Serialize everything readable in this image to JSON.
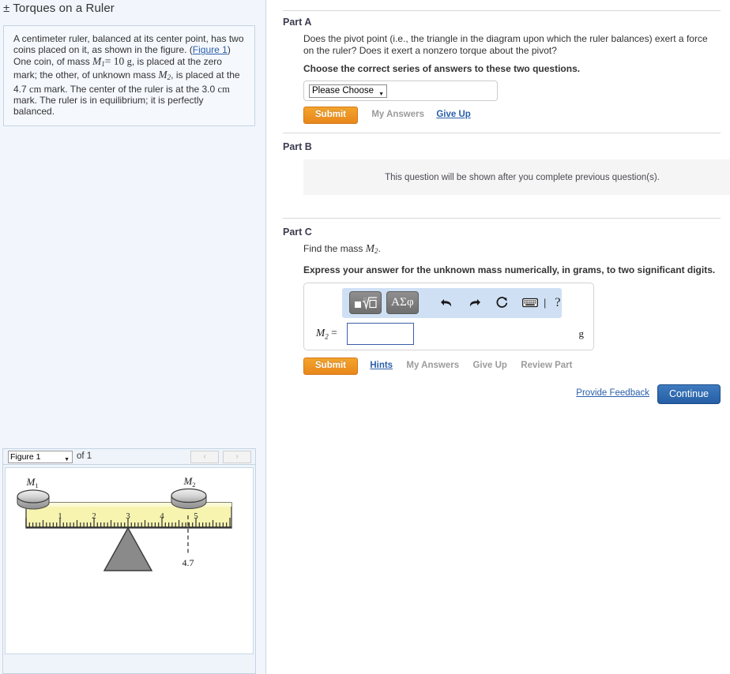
{
  "problem": {
    "title": "± Torques on a Ruler",
    "statement_parts": [
      "A centimeter ruler, balanced at its center point, has two coins placed on it, as shown in the figure. (",
      "Figure 1",
      ") One coin, of mass ",
      "M",
      "1",
      " = 10 ",
      "g",
      ", is placed at the zero mark; the other, of unknown mass ",
      "M",
      "2",
      ", is placed at the 4.7 ",
      "cm",
      " mark. The center of the ruler is at the 3.0 ",
      "cm",
      " mark. The ruler is in equilibrium; it is perfectly balanced."
    ],
    "figure_link": "Figure 1",
    "mass1_symbol": "M",
    "mass1_sub": "1",
    "mass1_value": "= 10",
    "mass1_unit": "g",
    "mass2_symbol": "M",
    "mass2_sub": "2",
    "coin2_position": "4.7",
    "center_position": "3.0",
    "unit_cm": "cm"
  },
  "parts": {
    "a": {
      "heading": "Part A",
      "question": "Does the pivot point (i.e., the triangle in the diagram upon which the ruler balances) exert a force on the ruler? Does it exert a nonzero torque about the pivot?",
      "instruction": "Choose the correct series of answers to these two questions.",
      "select_value": "Please Choose",
      "submit_label": "Submit",
      "my_answers_label": "My Answers",
      "give_up_label": "Give Up"
    },
    "b": {
      "heading": "Part B",
      "locked_message": "This question will be shown after you complete previous question(s)."
    },
    "c": {
      "heading": "Part C",
      "question_prefix": "Find the mass ",
      "question_symbol": "M",
      "question_sub": "2",
      "question_suffix": ".",
      "instruction": "Express your answer for the unknown mass numerically, in grams, to two significant digits.",
      "answer_label_symbol": "M",
      "answer_label_sub": "2",
      "answer_label_eq": "=",
      "answer_value": "",
      "answer_unit": "g",
      "submit_label": "Submit",
      "hints_label": "Hints",
      "my_answers_label": "My Answers",
      "give_up_label": "Give Up",
      "review_part_label": "Review Part",
      "toolbar": {
        "template_icon": "math-template-icon",
        "greek_label": "ΑΣφ",
        "undo_icon": "undo-arrow-icon",
        "redo_icon": "redo-arrow-icon",
        "reset_icon": "reset-circular-arrow-icon",
        "keyboard_icon": "keyboard-icon",
        "help_label": "?"
      }
    }
  },
  "footer": {
    "feedback_label": "Provide Feedback",
    "continue_label": "Continue"
  },
  "figure": {
    "select_value": "Figure 1",
    "of_label": "of 1",
    "prev_label": "‹",
    "next_label": "›",
    "labels": {
      "mass1": "M",
      "mass1_sub": "1",
      "mass2": "M",
      "mass2_sub": "2",
      "position_callout": "4.7"
    },
    "ruler_ticks": [
      "1",
      "2",
      "3",
      "4",
      "5"
    ],
    "ruler_color": "#f7f4b0",
    "pivot_color": "#8a8a8a",
    "coin_color": "#c9c9c9"
  },
  "colors": {
    "submit_orange": "#e8871b",
    "continue_blue": "#255ea4",
    "link_blue": "#2b5faa",
    "panel_bg": "#f2f6fc",
    "notice_bg": "#f5f5f5"
  }
}
